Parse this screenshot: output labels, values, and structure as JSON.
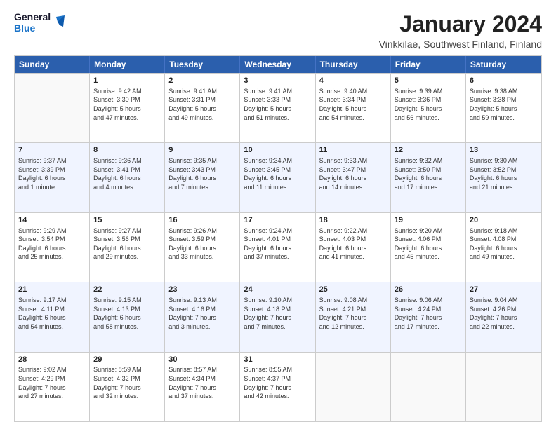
{
  "logo": {
    "line1": "General",
    "line2": "Blue"
  },
  "title": "January 2024",
  "subtitle": "Vinkkilae, Southwest Finland, Finland",
  "days": [
    "Sunday",
    "Monday",
    "Tuesday",
    "Wednesday",
    "Thursday",
    "Friday",
    "Saturday"
  ],
  "weeks": [
    [
      {
        "day": "",
        "info": ""
      },
      {
        "day": "1",
        "info": "Sunrise: 9:42 AM\nSunset: 3:30 PM\nDaylight: 5 hours\nand 47 minutes."
      },
      {
        "day": "2",
        "info": "Sunrise: 9:41 AM\nSunset: 3:31 PM\nDaylight: 5 hours\nand 49 minutes."
      },
      {
        "day": "3",
        "info": "Sunrise: 9:41 AM\nSunset: 3:33 PM\nDaylight: 5 hours\nand 51 minutes."
      },
      {
        "day": "4",
        "info": "Sunrise: 9:40 AM\nSunset: 3:34 PM\nDaylight: 5 hours\nand 54 minutes."
      },
      {
        "day": "5",
        "info": "Sunrise: 9:39 AM\nSunset: 3:36 PM\nDaylight: 5 hours\nand 56 minutes."
      },
      {
        "day": "6",
        "info": "Sunrise: 9:38 AM\nSunset: 3:38 PM\nDaylight: 5 hours\nand 59 minutes."
      }
    ],
    [
      {
        "day": "7",
        "info": "Sunrise: 9:37 AM\nSunset: 3:39 PM\nDaylight: 6 hours\nand 1 minute."
      },
      {
        "day": "8",
        "info": "Sunrise: 9:36 AM\nSunset: 3:41 PM\nDaylight: 6 hours\nand 4 minutes."
      },
      {
        "day": "9",
        "info": "Sunrise: 9:35 AM\nSunset: 3:43 PM\nDaylight: 6 hours\nand 7 minutes."
      },
      {
        "day": "10",
        "info": "Sunrise: 9:34 AM\nSunset: 3:45 PM\nDaylight: 6 hours\nand 11 minutes."
      },
      {
        "day": "11",
        "info": "Sunrise: 9:33 AM\nSunset: 3:47 PM\nDaylight: 6 hours\nand 14 minutes."
      },
      {
        "day": "12",
        "info": "Sunrise: 9:32 AM\nSunset: 3:50 PM\nDaylight: 6 hours\nand 17 minutes."
      },
      {
        "day": "13",
        "info": "Sunrise: 9:30 AM\nSunset: 3:52 PM\nDaylight: 6 hours\nand 21 minutes."
      }
    ],
    [
      {
        "day": "14",
        "info": "Sunrise: 9:29 AM\nSunset: 3:54 PM\nDaylight: 6 hours\nand 25 minutes."
      },
      {
        "day": "15",
        "info": "Sunrise: 9:27 AM\nSunset: 3:56 PM\nDaylight: 6 hours\nand 29 minutes."
      },
      {
        "day": "16",
        "info": "Sunrise: 9:26 AM\nSunset: 3:59 PM\nDaylight: 6 hours\nand 33 minutes."
      },
      {
        "day": "17",
        "info": "Sunrise: 9:24 AM\nSunset: 4:01 PM\nDaylight: 6 hours\nand 37 minutes."
      },
      {
        "day": "18",
        "info": "Sunrise: 9:22 AM\nSunset: 4:03 PM\nDaylight: 6 hours\nand 41 minutes."
      },
      {
        "day": "19",
        "info": "Sunrise: 9:20 AM\nSunset: 4:06 PM\nDaylight: 6 hours\nand 45 minutes."
      },
      {
        "day": "20",
        "info": "Sunrise: 9:18 AM\nSunset: 4:08 PM\nDaylight: 6 hours\nand 49 minutes."
      }
    ],
    [
      {
        "day": "21",
        "info": "Sunrise: 9:17 AM\nSunset: 4:11 PM\nDaylight: 6 hours\nand 54 minutes."
      },
      {
        "day": "22",
        "info": "Sunrise: 9:15 AM\nSunset: 4:13 PM\nDaylight: 6 hours\nand 58 minutes."
      },
      {
        "day": "23",
        "info": "Sunrise: 9:13 AM\nSunset: 4:16 PM\nDaylight: 7 hours\nand 3 minutes."
      },
      {
        "day": "24",
        "info": "Sunrise: 9:10 AM\nSunset: 4:18 PM\nDaylight: 7 hours\nand 7 minutes."
      },
      {
        "day": "25",
        "info": "Sunrise: 9:08 AM\nSunset: 4:21 PM\nDaylight: 7 hours\nand 12 minutes."
      },
      {
        "day": "26",
        "info": "Sunrise: 9:06 AM\nSunset: 4:24 PM\nDaylight: 7 hours\nand 17 minutes."
      },
      {
        "day": "27",
        "info": "Sunrise: 9:04 AM\nSunset: 4:26 PM\nDaylight: 7 hours\nand 22 minutes."
      }
    ],
    [
      {
        "day": "28",
        "info": "Sunrise: 9:02 AM\nSunset: 4:29 PM\nDaylight: 7 hours\nand 27 minutes."
      },
      {
        "day": "29",
        "info": "Sunrise: 8:59 AM\nSunset: 4:32 PM\nDaylight: 7 hours\nand 32 minutes."
      },
      {
        "day": "30",
        "info": "Sunrise: 8:57 AM\nSunset: 4:34 PM\nDaylight: 7 hours\nand 37 minutes."
      },
      {
        "day": "31",
        "info": "Sunrise: 8:55 AM\nSunset: 4:37 PM\nDaylight: 7 hours\nand 42 minutes."
      },
      {
        "day": "",
        "info": ""
      },
      {
        "day": "",
        "info": ""
      },
      {
        "day": "",
        "info": ""
      }
    ]
  ]
}
